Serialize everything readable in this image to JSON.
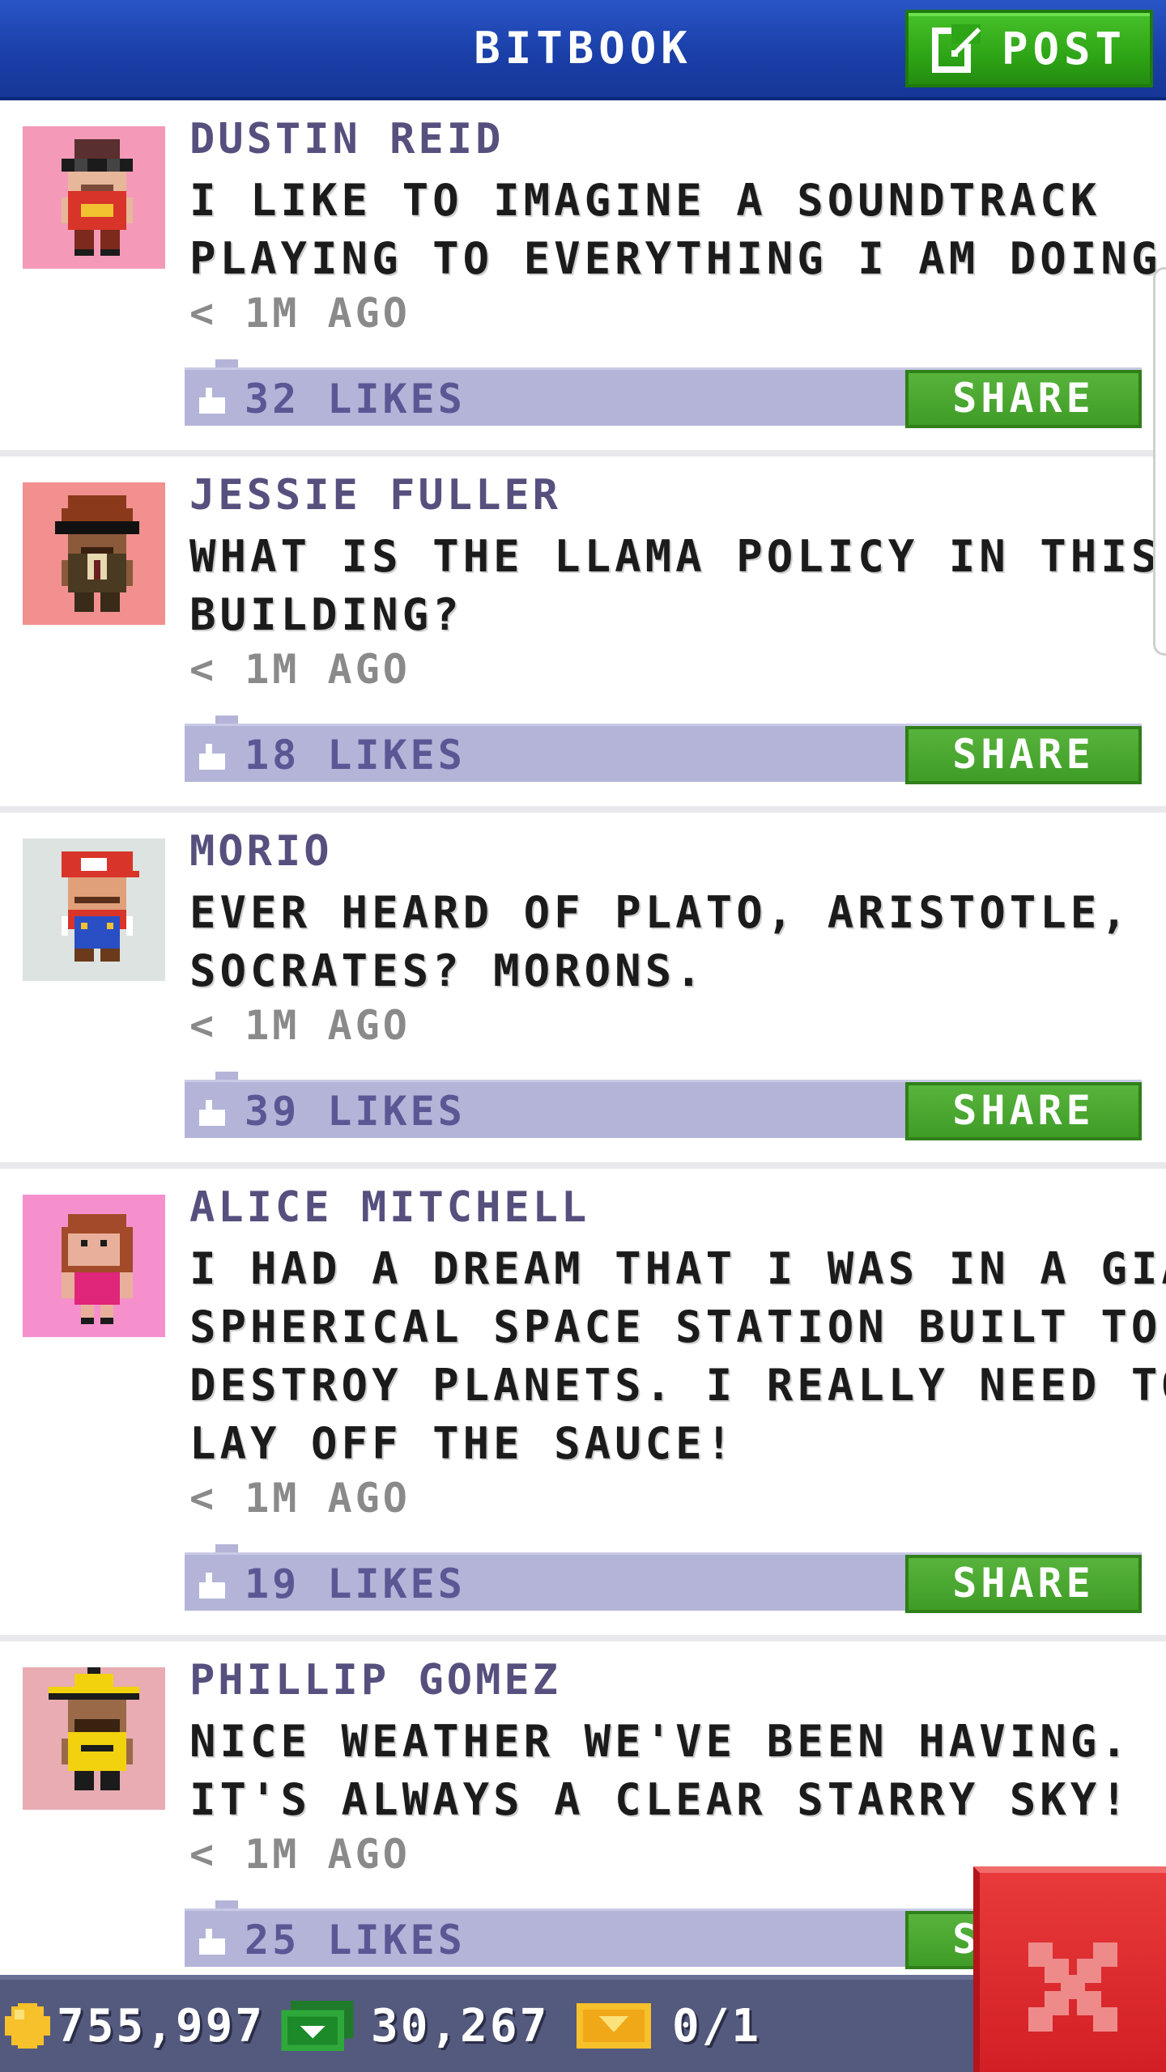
{
  "header": {
    "title": "BITBOOK",
    "post_label": "POST",
    "colors": {
      "bar": "#1a3fa8",
      "post_button": "#2ea516"
    }
  },
  "posts": [
    {
      "author": "DUSTIN REID",
      "lines": [
        "I LIKE TO IMAGINE A SOUNDTRACK",
        "PLAYING TO EVERYTHING I AM DOING."
      ],
      "time": "< 1M AGO",
      "likes": "32 LIKES",
      "share": "SHARE",
      "avatar_bg": "#f49ab8"
    },
    {
      "author": "JESSIE FULLER",
      "lines": [
        "WHAT IS THE LLAMA POLICY IN THIS",
        "BUILDING?"
      ],
      "time": "< 1M AGO",
      "likes": "18 LIKES",
      "share": "SHARE",
      "avatar_bg": "#f29090"
    },
    {
      "author": "MORIO",
      "lines": [
        "EVER HEARD OF PLATO, ARISTOTLE,",
        "SOCRATES? MORONS."
      ],
      "time": "< 1M AGO",
      "likes": "39 LIKES",
      "share": "SHARE",
      "avatar_bg": "#dde3e1"
    },
    {
      "author": "ALICE MITCHELL",
      "lines": [
        "I HAD A DREAM THAT I WAS IN A GIANT",
        "SPHERICAL SPACE STATION BUILT TO",
        "DESTROY PLANETS. I REALLY NEED TO",
        "LAY OFF THE SAUCE!"
      ],
      "time": "< 1M AGO",
      "likes": "19 LIKES",
      "share": "SHARE",
      "avatar_bg": "#f690cc"
    },
    {
      "author": "PHILLIP GOMEZ",
      "lines": [
        "NICE WEATHER WE'VE BEEN HAVING.",
        "IT'S ALWAYS A CLEAR STARRY SKY!"
      ],
      "time": "< 1M AGO",
      "likes": "25 LIKES",
      "share": "SHARE",
      "avatar_bg": "#e8acb2"
    }
  ],
  "bottom_bar": {
    "coins": "755,997",
    "bux": "30,267",
    "tickets": "0/1",
    "icons": [
      "coin-icon",
      "bux-icon",
      "ticket-icon"
    ]
  },
  "close": {
    "icon": "close-icon",
    "color": "#d21f25"
  }
}
